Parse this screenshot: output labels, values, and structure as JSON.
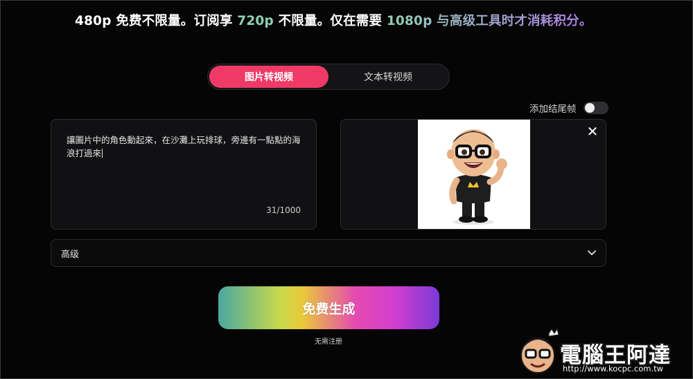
{
  "headline": {
    "part1": "480p 免费不限量。订阅享 ",
    "part2": "720p",
    "part3": " 不限量。仅在需要 ",
    "part4": "1080p 与高级工具时才消耗积分。"
  },
  "mode_switch": {
    "tabs": [
      {
        "label": "图片转视频",
        "active": true
      },
      {
        "label": "文本转视频",
        "active": false
      }
    ]
  },
  "end_frame": {
    "label": "添加结尾帧",
    "enabled": false
  },
  "prompt": {
    "text": "讓圖片中的角色動起來，在沙灘上玩排球，旁邊有一點點的海浪打過來",
    "char_count": "31/1000"
  },
  "image_upload": {
    "close_icon": "close-icon",
    "has_image": true
  },
  "advanced": {
    "label": "高级",
    "icon": "chevron-down-icon"
  },
  "generate": {
    "label": "免费生成",
    "subtext": "无需注册"
  },
  "watermark": {
    "title": "電腦王阿達",
    "url": "http://www.kocpc.com.tw"
  },
  "colors": {
    "background": "#050505",
    "accent_pink": "#ef3a67",
    "accent_teal": "#8fd1b3",
    "panel": "#111113"
  }
}
